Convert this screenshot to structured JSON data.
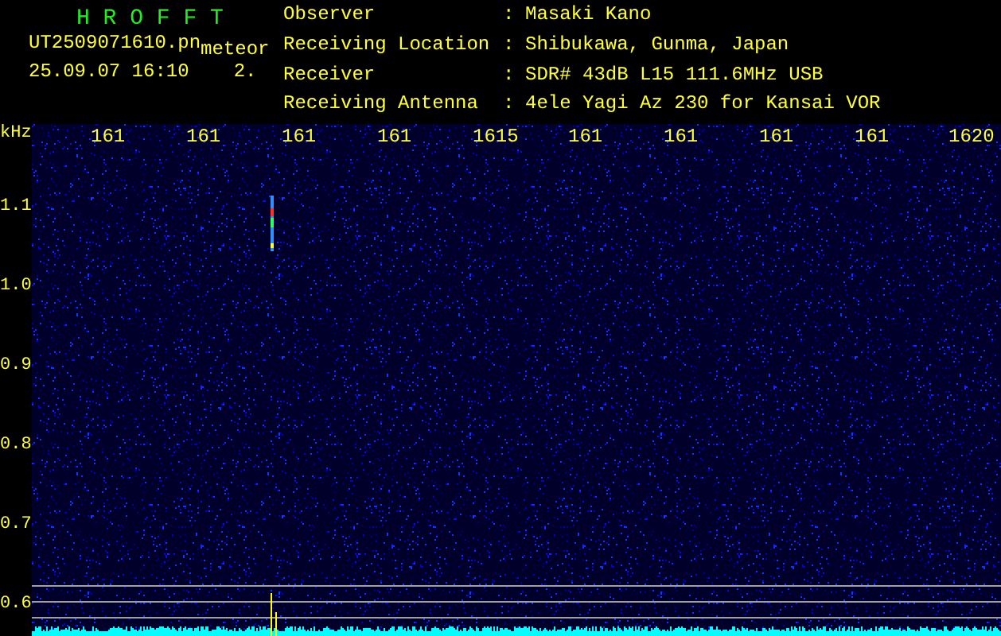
{
  "header": {
    "title": "H R O F F T",
    "filename": "UT2509071610.pn",
    "event_type": "meteor",
    "timestamp": "25.09.07 16:10",
    "count": "2."
  },
  "station_info": [
    {
      "label": "Observer",
      "separator": ":",
      "value": "Masaki Kano"
    },
    {
      "label": "Receiving Location",
      "separator": ":",
      "value": "Shibukawa, Gunma, Japan"
    },
    {
      "label": "Receiver",
      "separator": ":",
      "value": "SDR# 43dB L15 111.6MHz USB"
    },
    {
      "label": "Receiving Antenna",
      "separator": ":",
      "value": "4ele Yagi Az 230 for Kansai VOR"
    }
  ],
  "plot": {
    "y_unit": "kHz",
    "y_labels": [
      "1.1",
      "1.0",
      "0.9",
      "0.8",
      "0.7",
      "0.6"
    ],
    "x_labels": [
      "161",
      "161",
      "161",
      "161",
      "1615",
      "161",
      "161",
      "161",
      "161",
      "1620"
    ]
  }
}
